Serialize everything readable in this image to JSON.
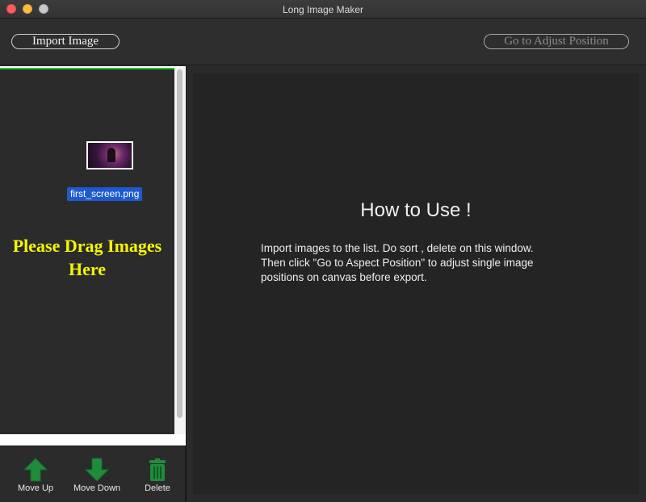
{
  "window": {
    "title": "Long Image Maker"
  },
  "toolbar": {
    "import_label": "Import Image",
    "adjust_label": "Go to Adjust Position"
  },
  "list": {
    "items": [
      {
        "filename": "first_screen.png"
      }
    ],
    "drag_hint": "Please Drag Images\nHere"
  },
  "actions": {
    "move_up": "Move Up",
    "move_down": "Move Down",
    "delete": "Delete"
  },
  "help": {
    "title": "How to Use !",
    "body": "Import images to the list.  Do sort , delete on this window.\nThen click \"Go to Aspect Position\" to adjust single image\npositions on canvas before export."
  },
  "colors": {
    "accent_green": "#25c62a",
    "hint_yellow": "#f6f600",
    "selection_blue": "#1c5ad0",
    "arrow_green": "#1e8c3a"
  }
}
